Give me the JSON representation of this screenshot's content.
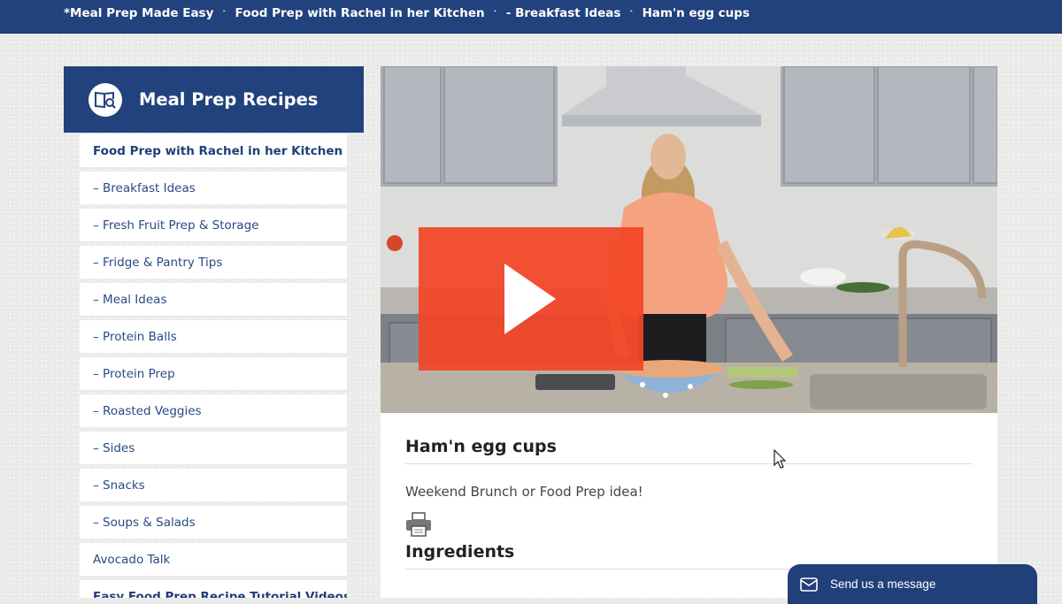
{
  "breadcrumb": {
    "items": [
      "*Meal Prep Made Easy",
      "Food Prep with Rachel in her Kitchen",
      "- Breakfast Ideas",
      "Ham'n egg cups"
    ],
    "separator": "‣"
  },
  "sidebar": {
    "title": "Meal Prep Recipes",
    "icon": "recipe-book-icon",
    "items": [
      {
        "label": "Food Prep with Rachel in her Kitchen"
      },
      {
        "label": "– Breakfast Ideas"
      },
      {
        "label": "– Fresh Fruit Prep & Storage"
      },
      {
        "label": "– Fridge & Pantry Tips"
      },
      {
        "label": "– Meal Ideas"
      },
      {
        "label": "– Protein Balls"
      },
      {
        "label": "– Protein Prep"
      },
      {
        "label": "– Roasted Veggies"
      },
      {
        "label": "– Sides"
      },
      {
        "label": "– Snacks"
      },
      {
        "label": "– Soups & Salads"
      },
      {
        "label": "Avocado Talk"
      },
      {
        "label": "Easy Food Prep Recipe Tutorial Videos"
      }
    ]
  },
  "video": {
    "play_icon": "play-icon"
  },
  "post": {
    "title": "Ham'n egg cups",
    "subtitle": "Weekend Brunch or Food Prep idea!",
    "print_icon": "printer-icon",
    "section_heading": "Ingredients"
  },
  "chat": {
    "label": "Send us a message",
    "icon": "envelope-icon"
  },
  "colors": {
    "brand_blue": "#22427e",
    "play_red": "#f34526",
    "link_blue": "#274a85"
  }
}
